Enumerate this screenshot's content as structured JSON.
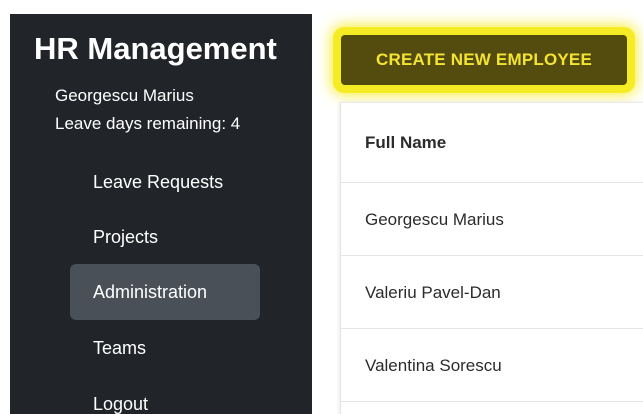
{
  "sidebar": {
    "title": "HR Management",
    "user_name": "Georgescu Marius",
    "leave_days": "Leave days remaining: 4",
    "items": [
      {
        "label": "Leave Requests",
        "active": false
      },
      {
        "label": "Projects",
        "active": false
      },
      {
        "label": "Administration",
        "active": true
      },
      {
        "label": "Teams",
        "active": false
      },
      {
        "label": "Logout",
        "active": false
      }
    ]
  },
  "main": {
    "create_button_label": "CREATE NEW EMPLOYEE",
    "table": {
      "columns": [
        "Full Name"
      ],
      "rows": [
        {
          "full_name": "Georgescu Marius"
        },
        {
          "full_name": "Valeriu Pavel-Dan"
        },
        {
          "full_name": "Valentina Sorescu"
        }
      ]
    }
  },
  "colors": {
    "sidebar_bg": "#212529",
    "active_item_bg": "#495057",
    "button_bg": "#544c0f",
    "button_text": "#f3e431",
    "highlight": "#f5ec24"
  }
}
